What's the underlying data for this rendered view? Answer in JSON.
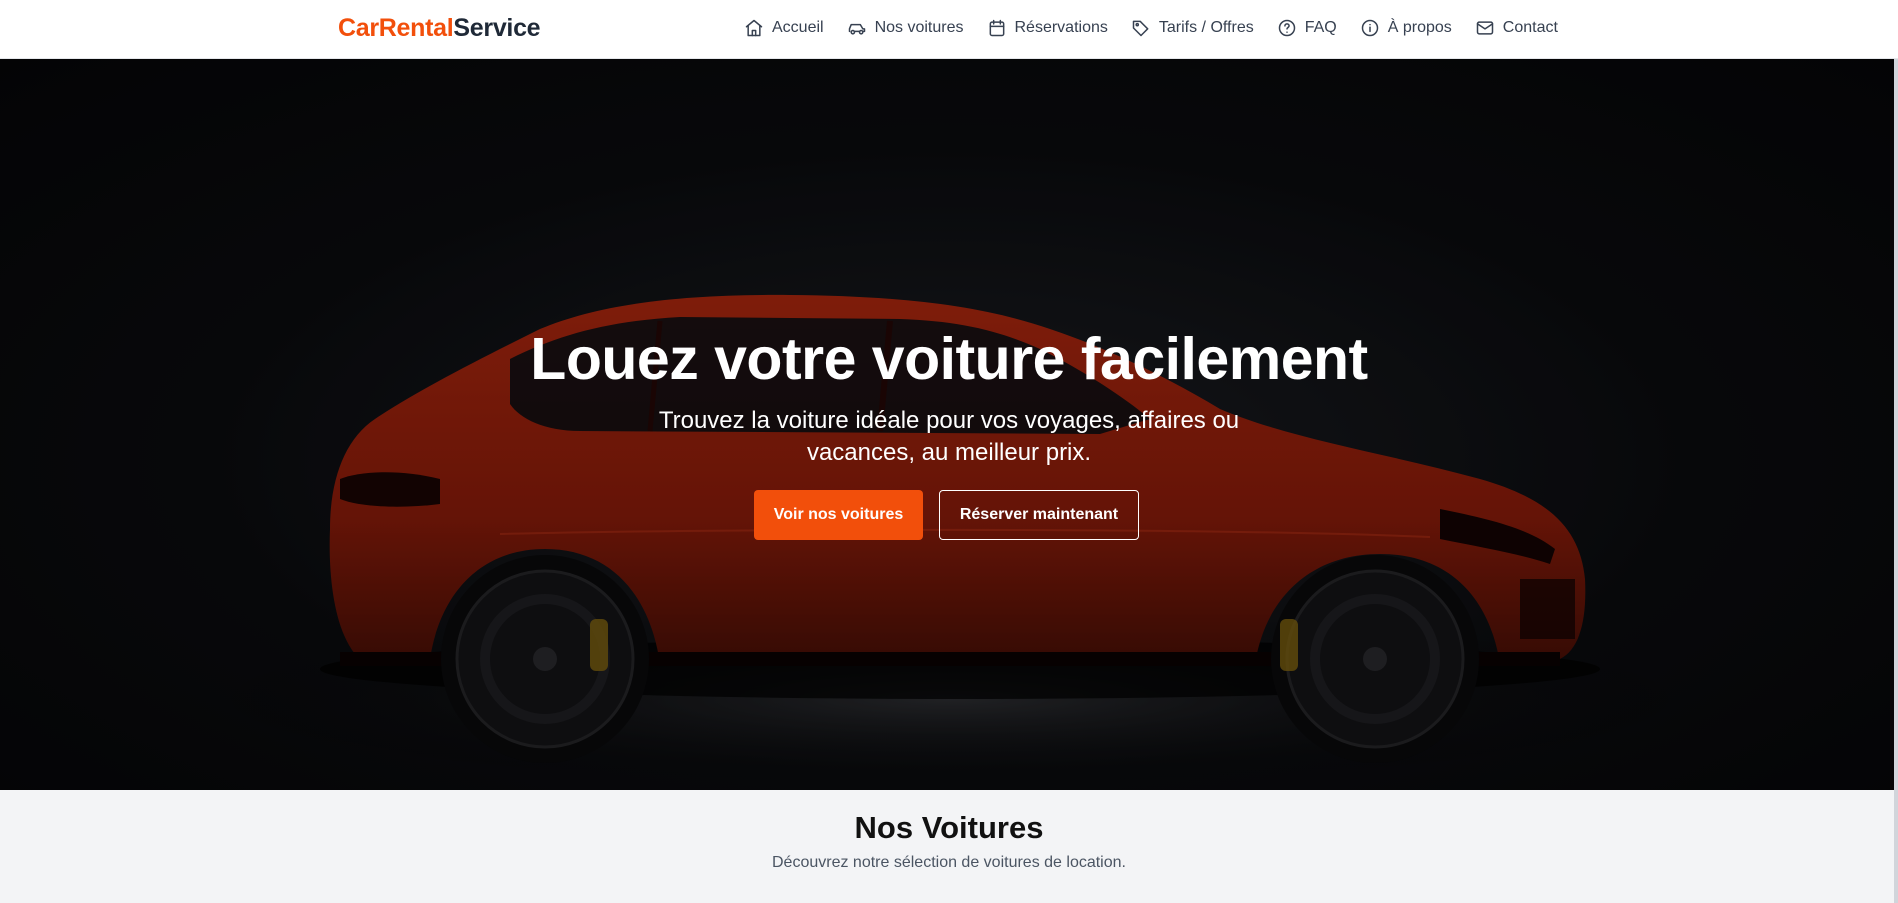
{
  "header": {
    "brand": {
      "part1": "CarRental",
      "part2": "Service"
    },
    "nav": [
      {
        "label": "Accueil",
        "icon": "home-icon"
      },
      {
        "label": "Nos voitures",
        "icon": "car-icon"
      },
      {
        "label": "Réservations",
        "icon": "calendar-icon"
      },
      {
        "label": "Tarifs / Offres",
        "icon": "tag-icon"
      },
      {
        "label": "FAQ",
        "icon": "help-circle-icon"
      },
      {
        "label": "À propos",
        "icon": "info-icon"
      },
      {
        "label": "Contact",
        "icon": "mail-icon"
      }
    ]
  },
  "hero": {
    "title": "Louez votre voiture facilement",
    "subtitle": "Trouvez la voiture idéale pour vos voyages, affaires ou vacances, au meilleur prix.",
    "primary_button": "Voir nos voitures",
    "secondary_button": "Réserver maintenant"
  },
  "cars_section": {
    "title": "Nos Voitures",
    "subtitle": "Découvrez notre sélection de voitures de location."
  },
  "colors": {
    "accent": "#f24f0b",
    "text_dark": "#1f2937",
    "section_bg": "#f3f4f6",
    "car_body": "#a3230f"
  }
}
